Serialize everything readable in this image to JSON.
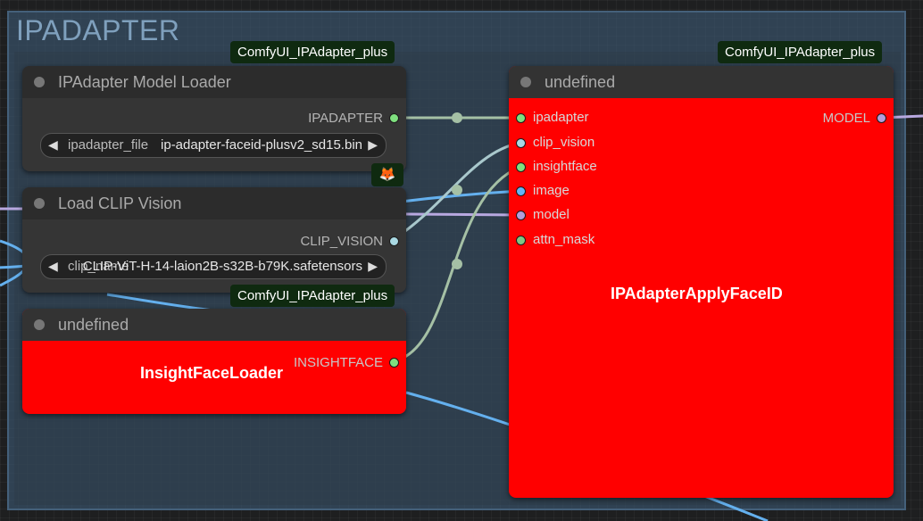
{
  "group": {
    "title": "IPADAPTER"
  },
  "badges": {
    "loader": "ComfyUI_IPAdapter_plus",
    "apply": "ComfyUI_IPAdapter_plus",
    "insight": "ComfyUI_IPAdapter_plus",
    "fox_icon": "fox-icon"
  },
  "nodes": {
    "model_loader": {
      "title": "IPAdapter Model Loader",
      "output": "IPADAPTER",
      "widget_name": "ipadapter_file",
      "widget_value": "ip-adapter-faceid-plusv2_sd15.bin"
    },
    "clip_vision": {
      "title": "Load CLIP Vision",
      "output": "CLIP_VISION",
      "widget_name": "clip_name",
      "widget_value": "CLIP-ViT-H-14-laion2B-s32B-b79K.safetensors"
    },
    "insightface": {
      "title": "undefined",
      "center_label": "InsightFaceLoader",
      "output": "INSIGHTFACE"
    },
    "apply_faceid": {
      "title": "undefined",
      "center_label": "IPAdapterApplyFaceID",
      "output": "MODEL",
      "inputs": [
        "ipadapter",
        "clip_vision",
        "insightface",
        "image",
        "model",
        "attn_mask"
      ]
    }
  },
  "colors": {
    "ipadapter": "#7fe07f",
    "clip_vision": "#a9d9e3",
    "insightface": "#7fe07f",
    "image": "#64b5f6",
    "model": "#b39ddb",
    "attn_mask": "#81c784",
    "wire_green": "#a5c0a5",
    "wire_blue": "#64b0ee",
    "wire_purple": "#b8a8e0"
  }
}
